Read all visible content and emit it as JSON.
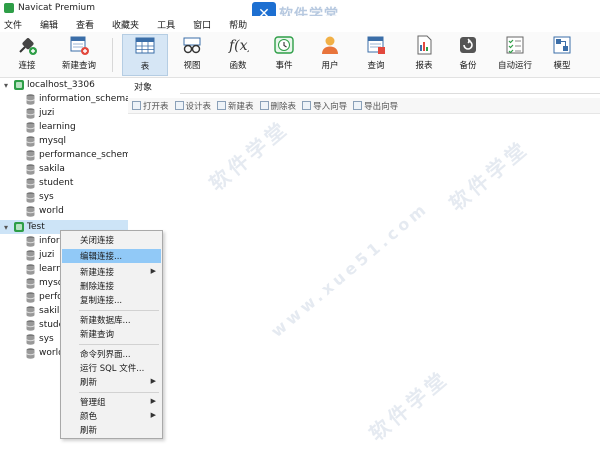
{
  "window": {
    "title": "Navicat Premium"
  },
  "logo": {
    "glyph": "✕",
    "text": "软件学堂"
  },
  "menubar": [
    "文件",
    "编辑",
    "查看",
    "收藏夹",
    "工具",
    "窗口",
    "帮助"
  ],
  "toolbar": {
    "connect": "连接",
    "new_query": "新建查询",
    "table": "表",
    "view": "视图",
    "function": "函数",
    "event": "事件",
    "user": "用户",
    "query": "查询",
    "report": "报表",
    "backup": "备份",
    "auto_run": "自动运行",
    "model": "模型"
  },
  "tree": {
    "connection1": "localhost_3306",
    "databases1": [
      "information_schema",
      "juzi",
      "learning",
      "mysql",
      "performance_schema",
      "sakila",
      "student",
      "sys",
      "world"
    ],
    "connection2": "Test",
    "databases2": [
      "information_schema",
      "juzi",
      "learning",
      "mysql",
      "performance_schema",
      "sakila",
      "student",
      "sys",
      "world"
    ]
  },
  "main": {
    "object_tab": "对象",
    "actions": [
      "打开表",
      "设计表",
      "新建表",
      "删除表",
      "导入向导",
      "导出向导"
    ]
  },
  "context_menu": [
    "关闭连接",
    "编辑连接...",
    "新建连接",
    "删除连接",
    "复制连接...",
    "新建数据库...",
    "新建查询",
    "命令列界面...",
    "运行 SQL 文件...",
    "刷新",
    "管理组",
    "颜色",
    "刷新"
  ],
  "watermarks": [
    "软件学堂",
    "www.xue51.com"
  ]
}
